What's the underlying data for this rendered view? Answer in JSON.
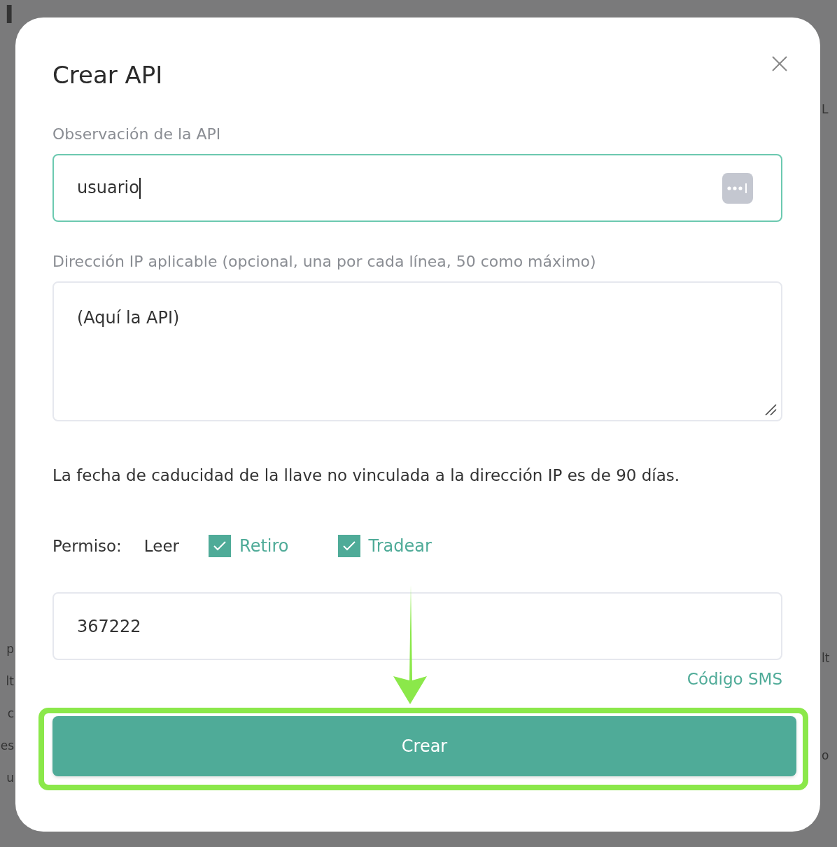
{
  "backdrop": {
    "left_fragments": [
      "I",
      "p",
      "lt",
      "c",
      "es",
      "u"
    ],
    "right_fragments": [
      "L",
      "lt",
      "o"
    ]
  },
  "dialog": {
    "title": "Crear API",
    "note_field": {
      "label": "Observación de la API",
      "value": "usuario",
      "focused": true
    },
    "ip_field": {
      "label": "Dirección IP aplicable (opcional, una por cada línea, 50 como máximo)",
      "value": "(Aquí la API)"
    },
    "notice": "La fecha de caducidad de la llave no vinculada a la dirección IP es de 90 días.",
    "permissions": {
      "label": "Permiso:",
      "items": [
        {
          "kind": "fixed",
          "label": "Leer"
        },
        {
          "kind": "checkbox",
          "label": "Retiro",
          "checked": true
        },
        {
          "kind": "checkbox",
          "label": "Tradear",
          "checked": true
        }
      ]
    },
    "code_field": {
      "value": "367222"
    },
    "sms_link": "Código SMS",
    "submit": "Crear"
  }
}
